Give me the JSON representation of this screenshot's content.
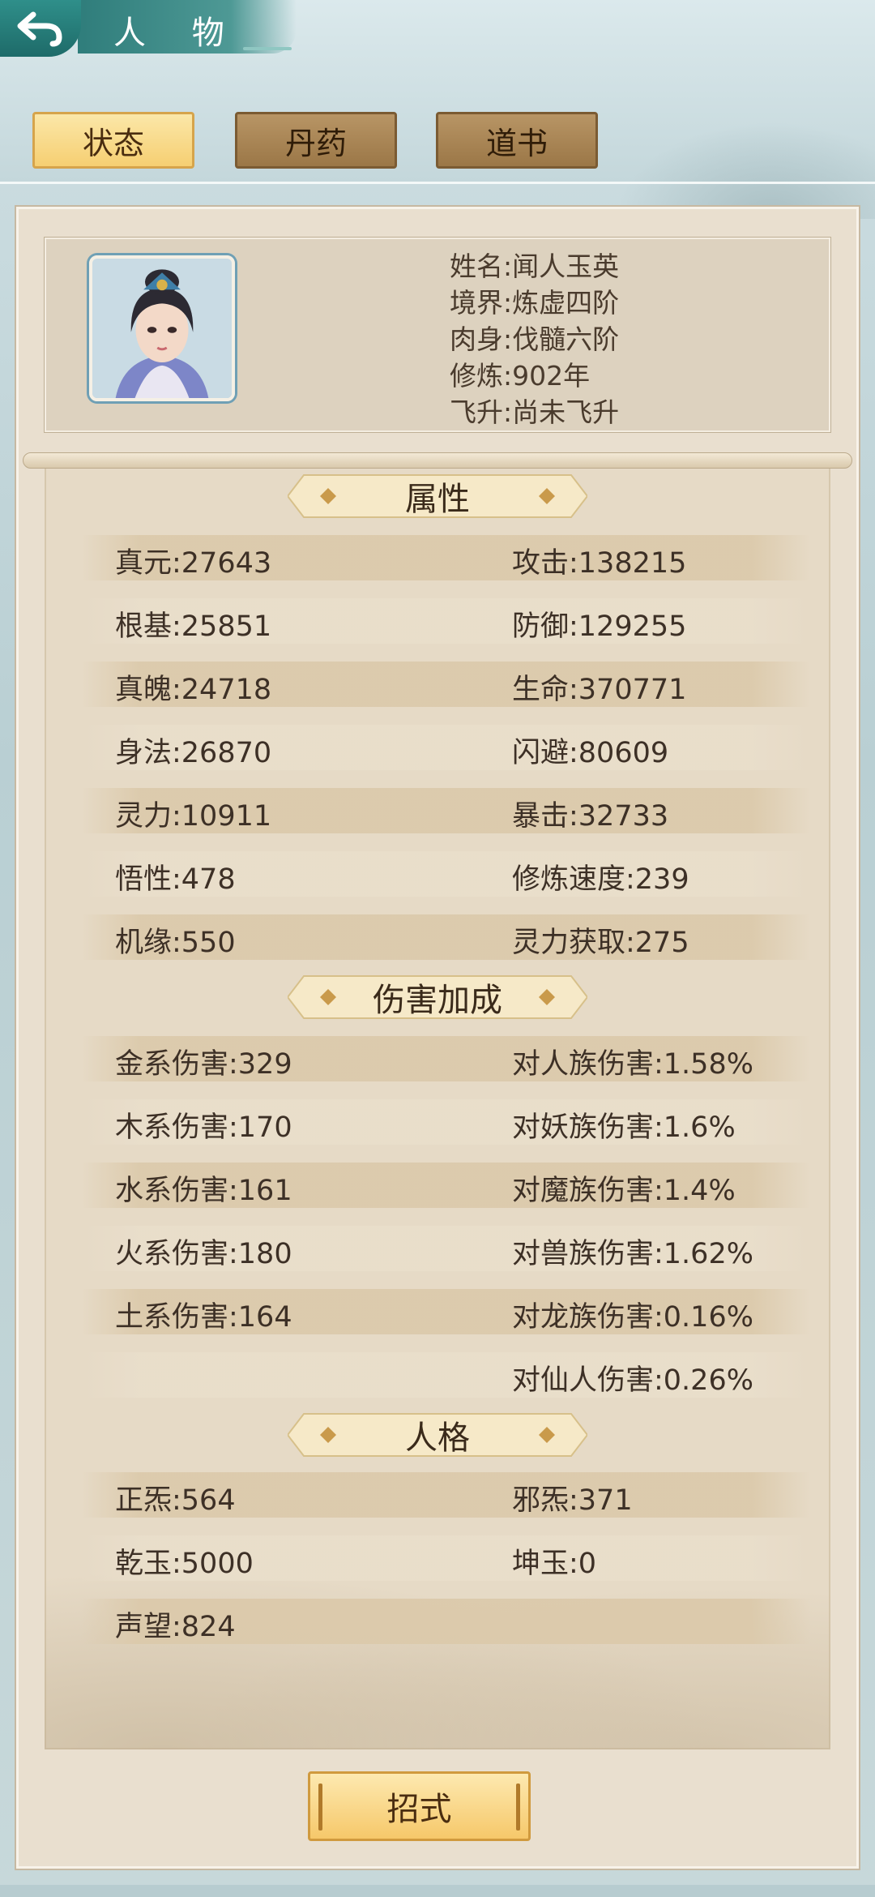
{
  "header": {
    "title": "人 物",
    "tabs": [
      {
        "label": "状态",
        "active": true
      },
      {
        "label": "丹药",
        "active": false
      },
      {
        "label": "道书",
        "active": false
      }
    ]
  },
  "profile": {
    "lines": [
      "姓名:闻人玉英",
      "境界:炼虚四阶",
      "肉身:伐髓六阶",
      "修炼:902年",
      "飞升:尚未飞升"
    ]
  },
  "sections": {
    "attributes": {
      "title": "属性",
      "rows": [
        [
          "真元:27643",
          "攻击:138215"
        ],
        [
          "根基:25851",
          "防御:129255"
        ],
        [
          "真魄:24718",
          "生命:370771"
        ],
        [
          "身法:26870",
          "闪避:80609"
        ],
        [
          "灵力:10911",
          "暴击:32733"
        ],
        [
          "悟性:478",
          "修炼速度:239"
        ],
        [
          "机缘:550",
          "灵力获取:275"
        ]
      ]
    },
    "damage": {
      "title": "伤害加成",
      "rows": [
        [
          "金系伤害:329",
          "对人族伤害:1.58%"
        ],
        [
          "木系伤害:170",
          "对妖族伤害:1.6%"
        ],
        [
          "水系伤害:161",
          "对魔族伤害:1.4%"
        ],
        [
          "火系伤害:180",
          "对兽族伤害:1.62%"
        ],
        [
          "土系伤害:164",
          "对龙族伤害:0.16%"
        ],
        [
          "",
          "对仙人伤害:0.26%"
        ]
      ]
    },
    "personality": {
      "title": "人格",
      "rows": [
        [
          "正炁:564",
          "邪炁:371"
        ],
        [
          "乾玉:5000",
          "坤玉:0"
        ],
        [
          "声望:824",
          ""
        ]
      ]
    }
  },
  "footer": {
    "button_label": "招式"
  },
  "colors": {
    "accent_teal": "#2f8f8a",
    "tab_active": "#f6cf72",
    "tab_inactive": "#9b7747",
    "panel": "#e9dfcf"
  }
}
